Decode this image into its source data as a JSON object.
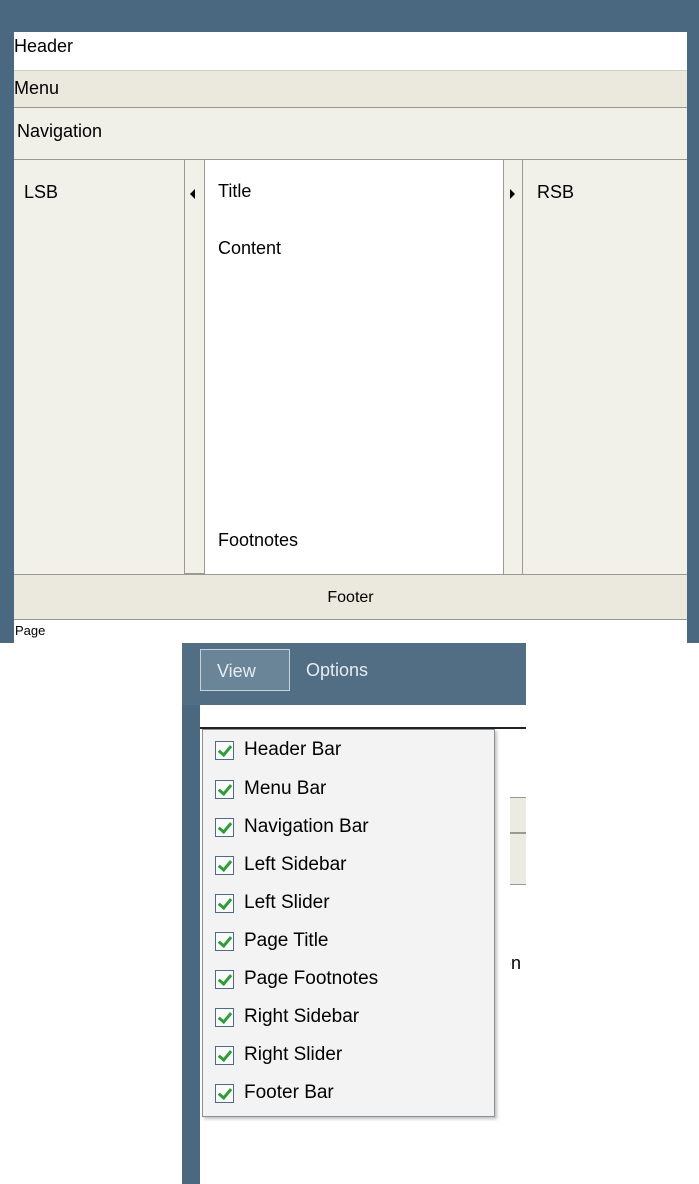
{
  "layout": {
    "header": "Header",
    "menu": "Menu",
    "navigation": "Navigation",
    "lsb": "LSB",
    "title": "Title",
    "content": "Content",
    "footnotes": "Footnotes",
    "rsb": "RSB",
    "footer": "Footer",
    "page": "Page"
  },
  "toolbar": {
    "view": "View",
    "options": "Options"
  },
  "view_menu": {
    "items": [
      {
        "label": "Header Bar",
        "checked": true
      },
      {
        "label": "Menu Bar",
        "checked": true
      },
      {
        "label": "Navigation Bar",
        "checked": true
      },
      {
        "label": "Left Sidebar",
        "checked": true
      },
      {
        "label": "Left Slider",
        "checked": true
      },
      {
        "label": "Page Title",
        "checked": true
      },
      {
        "label": "Page Footnotes",
        "checked": true
      },
      {
        "label": "Right Sidebar",
        "checked": true
      },
      {
        "label": "Right Slider",
        "checked": true
      },
      {
        "label": "Footer Bar",
        "checked": true
      }
    ]
  },
  "background_fragment": "ten",
  "colors": {
    "frame": "#4a6880",
    "toolbar": "#516e85",
    "bar_beige": "#ebe9dd",
    "sidebar": "#f1f1e9",
    "check": "#2f9d3a"
  }
}
